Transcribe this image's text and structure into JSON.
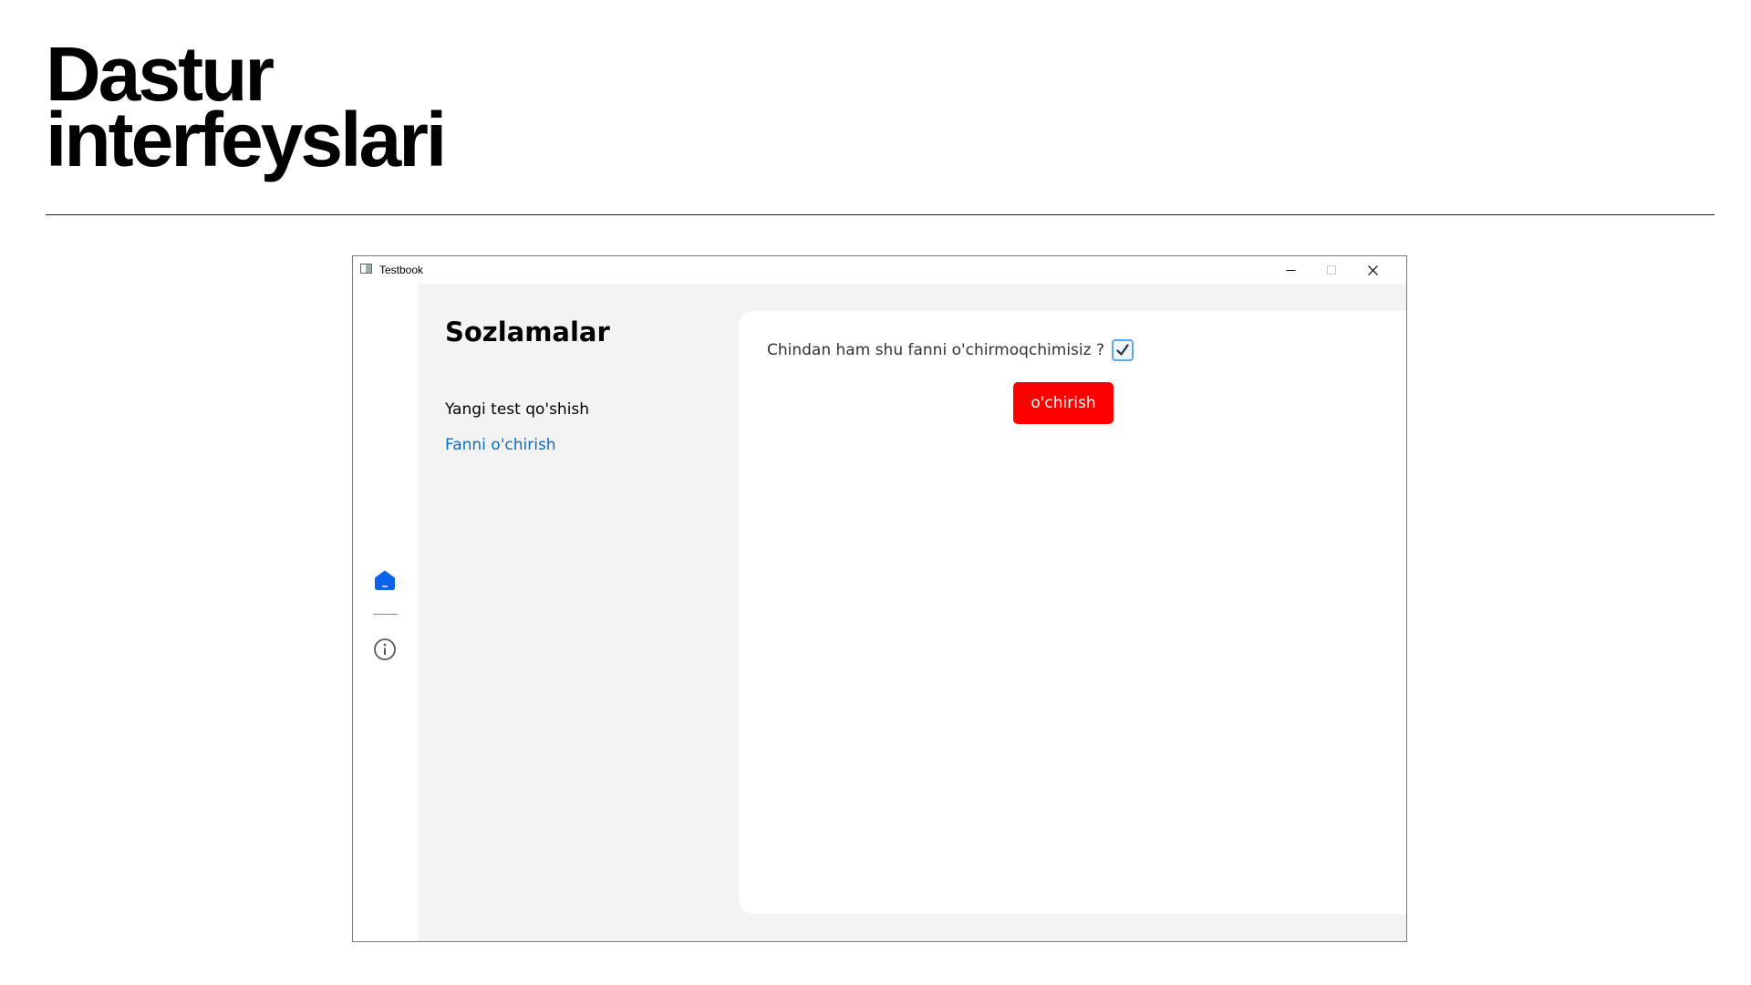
{
  "slide": {
    "title_line1": "Dastur",
    "title_line2": "interfeyslari"
  },
  "window": {
    "title": "Testbook",
    "controls": [
      "minimize-icon",
      "maximize-icon",
      "close-icon"
    ]
  },
  "rail": {
    "items": [
      {
        "icon": "home-icon",
        "active": true
      },
      {
        "icon": "info-icon",
        "active": false
      }
    ]
  },
  "settings": {
    "title": "Sozlamalar",
    "nav": [
      {
        "label": "Yangi test qo'shish",
        "active": false
      },
      {
        "label": "Fanni o'chirish",
        "active": true
      }
    ]
  },
  "confirm": {
    "question": "Chindan ham shu fanni o'chirmoqchimisiz ?",
    "checked": true,
    "delete_label": "o'chirish"
  },
  "colors": {
    "accent": "#0f6cbd",
    "rail_active": "#0a63e8",
    "danger": "#ff0000",
    "pane_bg": "#f3f3f3",
    "card_bg": "#ffffff"
  }
}
